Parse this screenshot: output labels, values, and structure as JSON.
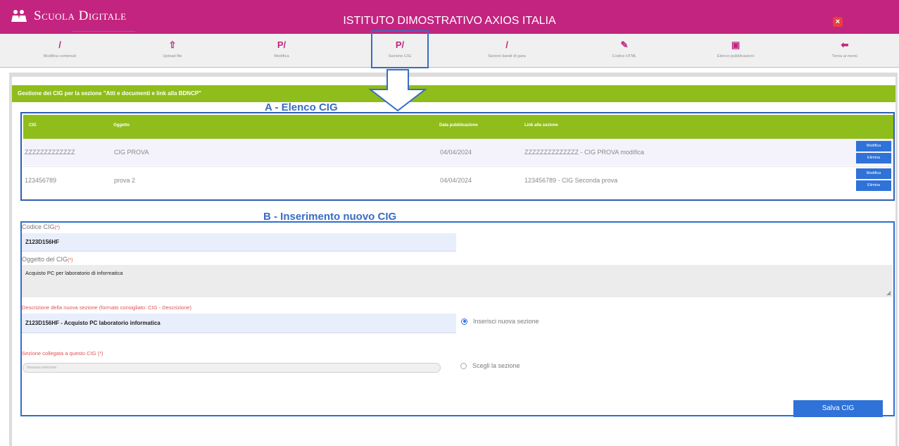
{
  "header": {
    "app_name": "Scuola Digitale",
    "school_name": "ISTITUTO DIMOSTRATIVO AXIOS ITALIA",
    "close_symbol": "×",
    "brand_color": "#c2247f"
  },
  "toolbar": {
    "items": [
      {
        "label": "Modifica contenuti",
        "icon": "pencil-icon",
        "glyph": "/"
      },
      {
        "label": "Upload file",
        "icon": "upload-icon",
        "glyph": "⇧"
      },
      {
        "label": "Modifica",
        "icon": "edit-paragraph-icon",
        "glyph": "P/"
      },
      {
        "label": "Sezione CIG",
        "icon": "edit-paragraph-icon",
        "glyph": "P/"
      },
      {
        "label": "Sezioni bandi di gara",
        "icon": "pencil-icon",
        "glyph": "/"
      },
      {
        "label": "Codice HTML",
        "icon": "brush-icon",
        "glyph": "✎"
      },
      {
        "label": "Elenco pubblicazioni",
        "icon": "document-icon",
        "glyph": "▣"
      },
      {
        "label": "Torna ai menù",
        "icon": "arrow-left-icon",
        "glyph": "⬅"
      }
    ]
  },
  "section": {
    "title": "Gestione dei CIG per la sezione \"Atti e documenti e link alla BDNCP\""
  },
  "annotations": {
    "a": "A - Elenco CIG",
    "b": "B - Inserimento nuovo CIG"
  },
  "table": {
    "headers": [
      "CIG",
      "Oggetto",
      "Data pubblicazione",
      "Link alla sezione"
    ],
    "rows": [
      {
        "cig": "ZZZZZZZZZZZZZ",
        "oggetto": "CIG PROVA",
        "data": "04/04/2024",
        "link": "ZZZZZZZZZZZZZZ - CIG PROVA modifica"
      },
      {
        "cig": "123456789",
        "oggetto": "prova 2",
        "data": "04/04/2024",
        "link": "123456789 - CIG Seconda prova"
      }
    ],
    "edit_label": "Modifica",
    "delete_label": "Elimina"
  },
  "form": {
    "cig_label": "Codice CIG",
    "cig_value": "Z123D156HF",
    "oggetto_label": "Oggetto del CIG",
    "oggetto_value": "Acquisto PC per laboratorio di informatica",
    "required_mark": "(*)",
    "desc_label": "Descrizione della nuova sezione (formato consigliato:  CIG - Descrizione)",
    "desc_value": "Z123D156HF - Acquisto PC laboratorio informatica",
    "radio_new": "Inserisci nuova sezione",
    "linked_label": "Sezione collegata a questo CIG (*)",
    "linked_placeholder": "Nessuna selezione",
    "radio_choose": "Scegli la sezione",
    "save_label": "Salva CIG"
  }
}
